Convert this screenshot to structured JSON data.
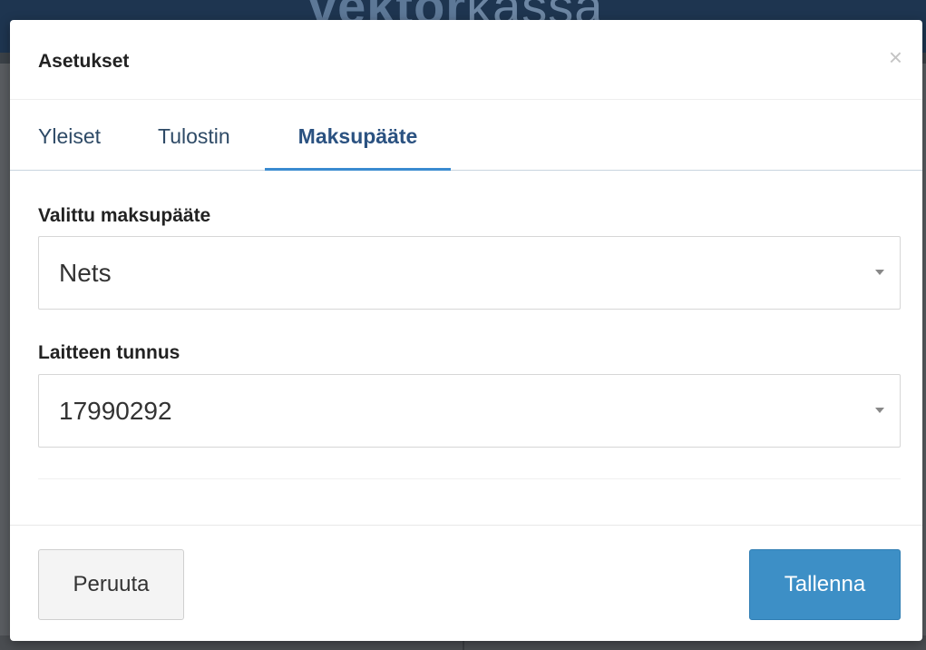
{
  "background": {
    "app_logo_bold": "vektor",
    "app_logo_light": "kassa"
  },
  "dialog": {
    "title": "Asetukset",
    "close_glyph": "×"
  },
  "tabs": [
    {
      "label": "Yleiset",
      "active": false
    },
    {
      "label": "Tulostin",
      "active": false
    },
    {
      "label": "Maksupääte",
      "active": true
    }
  ],
  "form": {
    "terminal_label": "Valittu maksupääte",
    "terminal_value": "Nets",
    "device_label": "Laitteen tunnus",
    "device_value": "17990292"
  },
  "footer": {
    "cancel_label": "Peruuta",
    "save_label": "Tallenna"
  },
  "colors": {
    "accent": "#3d8fc6",
    "active_tab_text": "#2b5281",
    "header_bg": "#1e3550"
  },
  "icons": {
    "close": "close-icon",
    "caret": "chevron-down-icon"
  }
}
